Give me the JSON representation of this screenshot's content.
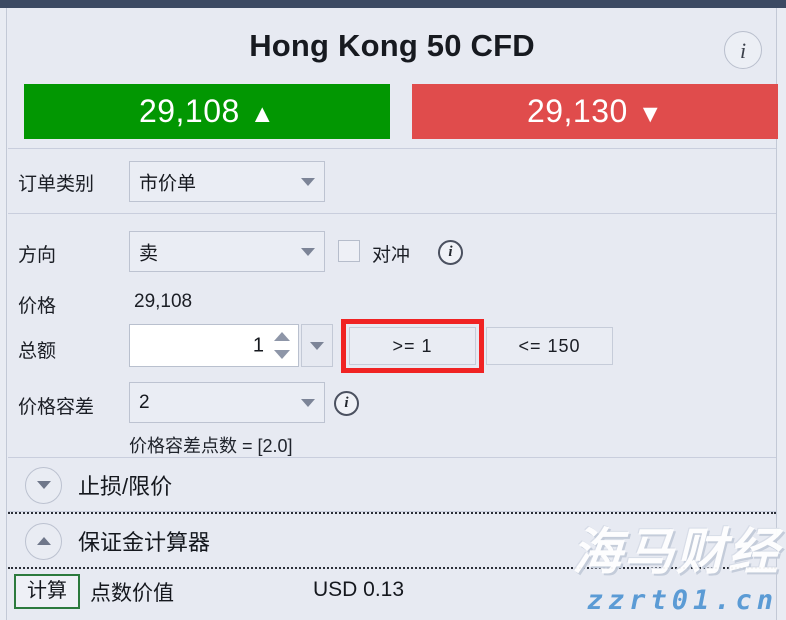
{
  "window": {
    "accent_titlebar": "#3c4a63",
    "panel_bg": "#e7eaf2"
  },
  "header": {
    "instrument": "Hong Kong 50 CFD",
    "info_icon": "info-icon",
    "bid": {
      "price": "29,108",
      "arrow": "▲",
      "color": "#029702"
    },
    "ask": {
      "price": "29,130",
      "arrow": "▼",
      "color": "#e04c4c"
    }
  },
  "form": {
    "order_type": {
      "label": "订单类别",
      "value": "市价单"
    },
    "direction": {
      "label": "方向",
      "value": "卖"
    },
    "hedge": {
      "label": "对冲",
      "checked": false
    },
    "price": {
      "label": "价格",
      "value": "29,108"
    },
    "amount": {
      "label": "总额",
      "value": "1",
      "min_button": ">= 1",
      "max_button": "<= 150",
      "highlight_color": "#f02323"
    },
    "tolerance": {
      "label": "价格容差",
      "value": "2",
      "note": "价格容差点数 = [2.0]"
    }
  },
  "sections": {
    "stop_limit": {
      "label": "止损/限价",
      "expanded": false
    },
    "margin_calculator": {
      "label": "保证金计算器",
      "expanded": true
    }
  },
  "calculator": {
    "calc_button": "计算",
    "row_label": "点数价值",
    "row_value": "USD 0.13",
    "button_border": "#2c7a3d"
  },
  "watermark": {
    "primary": "海马财经",
    "secondary": "zzrt01.cn"
  }
}
